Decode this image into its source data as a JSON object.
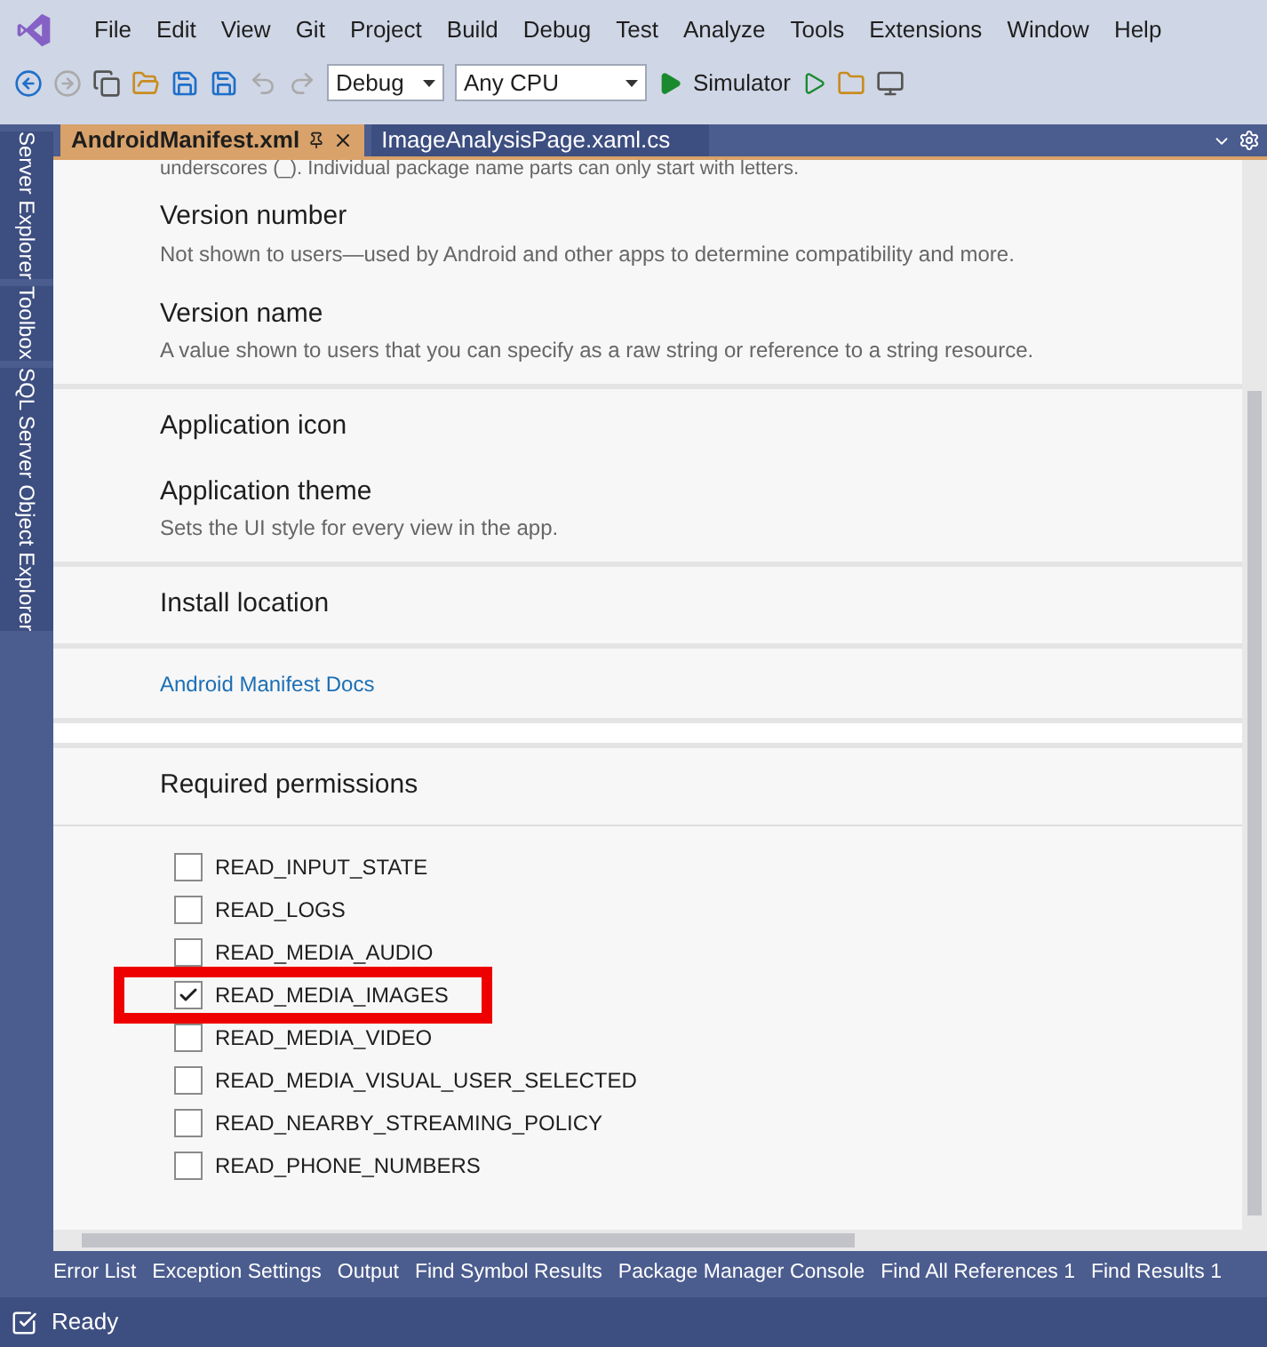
{
  "menu": [
    "File",
    "Edit",
    "View",
    "Git",
    "Project",
    "Build",
    "Debug",
    "Test",
    "Analyze",
    "Tools",
    "Extensions",
    "Window",
    "Help"
  ],
  "toolbar": {
    "configuration": "Debug",
    "platform": "Any CPU",
    "run_target": "Simulator"
  },
  "side_tabs": [
    "Server Explorer",
    "Toolbox",
    "SQL Server Object Explorer"
  ],
  "tabs": [
    {
      "label": "AndroidManifest.xml",
      "selected": true
    },
    {
      "label": "ImageAnalysisPage.xaml.cs",
      "selected": false
    }
  ],
  "partial_text": "underscores (_). Individual package name parts can only start with letters.",
  "sections": [
    {
      "kind": "group",
      "items": [
        {
          "title": "Version number",
          "description": "Not shown to users—used by Android and other apps to determine compatibility and more."
        },
        {
          "title": "Version name",
          "description": "A value shown to users that you can specify as a raw string or reference to a string resource."
        }
      ]
    },
    {
      "kind": "group",
      "items": [
        {
          "title": "Application icon"
        },
        {
          "title": "Application theme",
          "description": "Sets the UI style for every view in the app."
        }
      ]
    },
    {
      "kind": "group",
      "items": [
        {
          "title": "Install location"
        }
      ]
    },
    {
      "kind": "link",
      "label": "Android Manifest Docs"
    },
    {
      "kind": "blank"
    }
  ],
  "permissions": {
    "title": "Required permissions",
    "items": [
      {
        "label": "READ_INPUT_STATE",
        "checked": false,
        "highlighted": false
      },
      {
        "label": "READ_LOGS",
        "checked": false,
        "highlighted": false
      },
      {
        "label": "READ_MEDIA_AUDIO",
        "checked": false,
        "highlighted": false
      },
      {
        "label": "READ_MEDIA_IMAGES",
        "checked": true,
        "highlighted": true
      },
      {
        "label": "READ_MEDIA_VIDEO",
        "checked": false,
        "highlighted": false
      },
      {
        "label": "READ_MEDIA_VISUAL_USER_SELECTED",
        "checked": false,
        "highlighted": false
      },
      {
        "label": "READ_NEARBY_STREAMING_POLICY",
        "checked": false,
        "highlighted": false
      },
      {
        "label": "READ_PHONE_NUMBERS",
        "checked": false,
        "highlighted": false
      }
    ]
  },
  "bottom_tabs": [
    "Error List",
    "Exception Settings",
    "Output",
    "Find Symbol Results",
    "Package Manager Console",
    "Find All References 1",
    "Find Results 1"
  ],
  "status_bar": {
    "text": "Ready"
  }
}
